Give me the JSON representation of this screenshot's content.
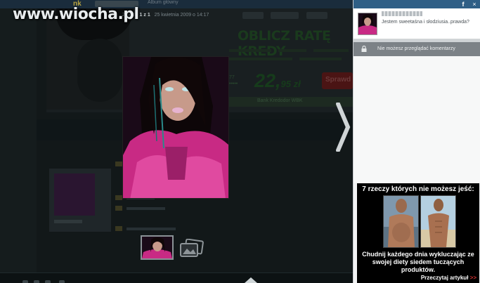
{
  "watermark": "www.wiocha.pl",
  "topbar": {
    "logo": "nk",
    "album_label": "Album główny"
  },
  "photo_info": {
    "prefix": "Zdjęcie",
    "current": "1 z 1",
    "date": "25 kwietnia 2009 o 14:17"
  },
  "background_ad": {
    "title": "OBLICZ RATĘ KREDY",
    "price": "22,",
    "price_small": "95 zł",
    "button": "Sprawd",
    "bar_text": "Bank Kredodor WBK"
  },
  "panel": {
    "facebook_label": "f",
    "close_label": "×",
    "description": "Jestem sweetaśna i słodziusia..prawda?",
    "notice": "Nie możesz przeglądać komentarzy"
  },
  "article_ad": {
    "title": "7 rzeczy których nie możesz jeść:",
    "description": "Chudnij każdego dnia wykluczając ze swojej diety siedem tuczących produktów.",
    "link": "Przeczytaj artykuł",
    "link_arrow": ">>"
  },
  "colors": {
    "panel_topbar": "#2f5f86",
    "notice_bg": "#7c8287",
    "ad_link_arrow": "#d43131",
    "photo_pink": "#c82a84"
  }
}
